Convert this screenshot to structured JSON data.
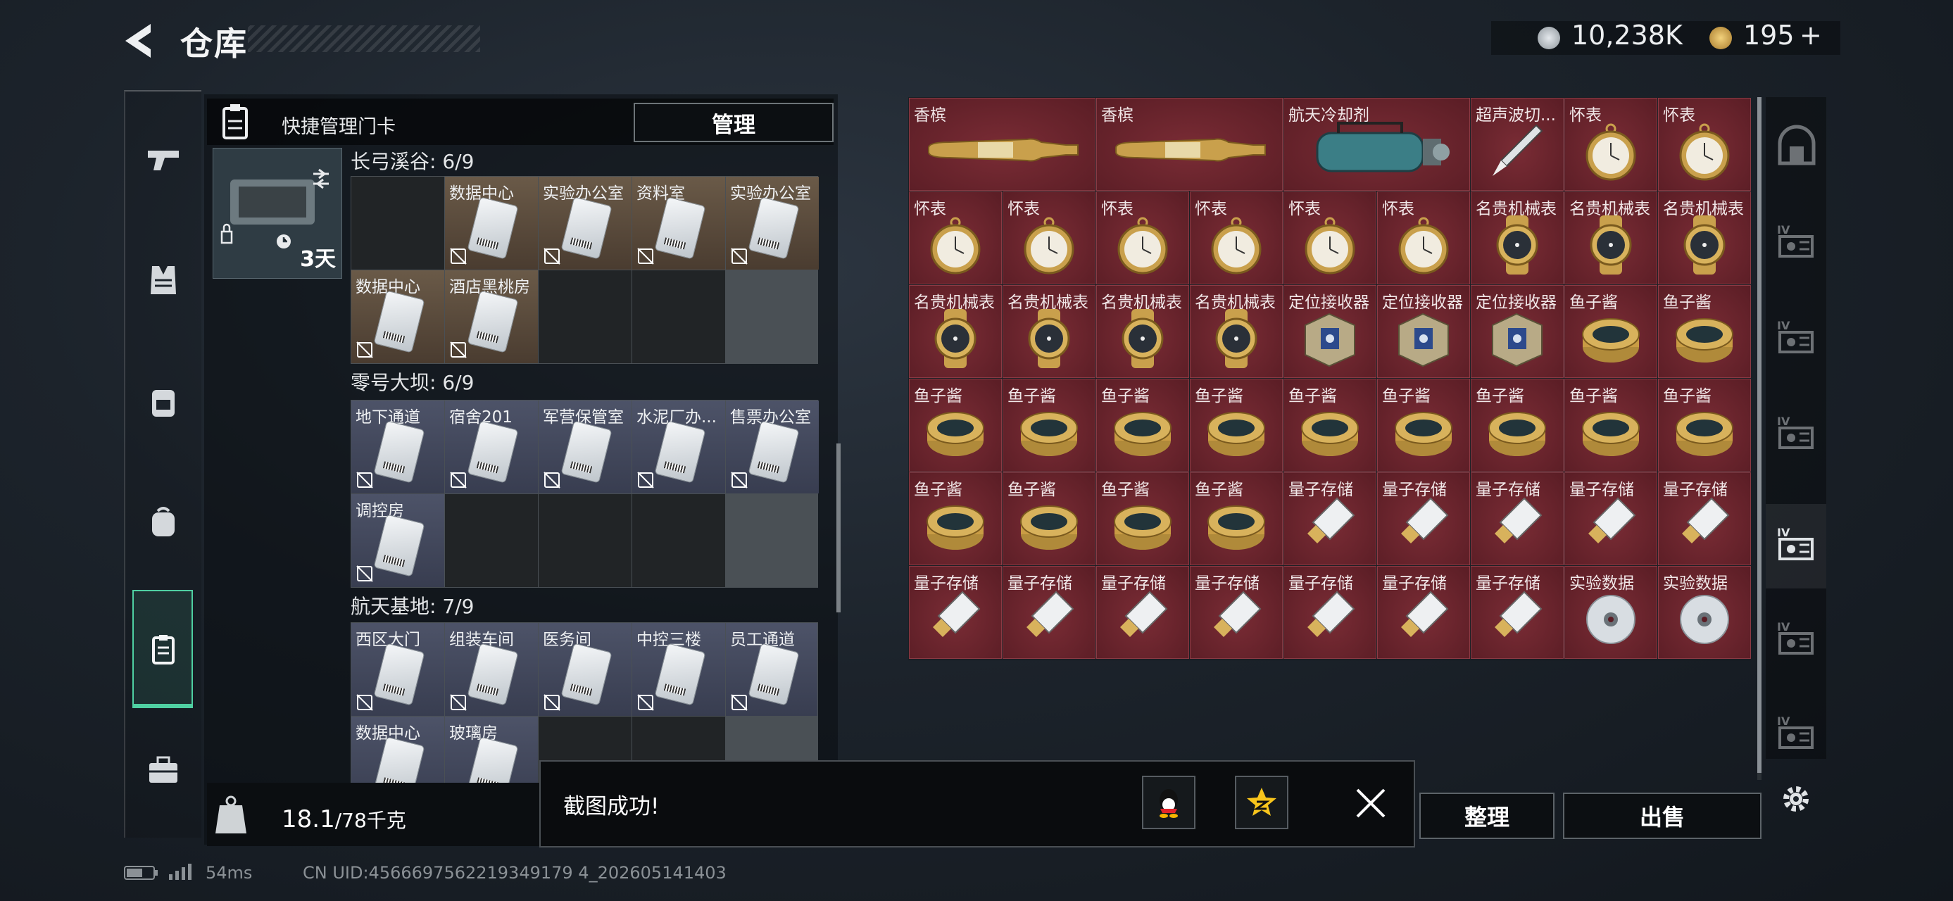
{
  "header": {
    "title": "仓库",
    "currency_silver": "10,238K",
    "currency_gold": "195",
    "gold_plus": "+"
  },
  "colors": {
    "accent": "#4fd0a2",
    "item_red": "#6e2530",
    "card_brown": "#5a4a3a",
    "card_blue": "#454a60"
  },
  "sidebar": {
    "icons": [
      "pistol-icon",
      "armor-vest-icon",
      "backpack-rig-icon",
      "backpack-icon",
      "keycard-holder-icon",
      "toolbox-icon"
    ],
    "active_index": 4
  },
  "key_panel": {
    "header_label": "快捷管理门卡",
    "manage_button": "管理",
    "selected_key_time": "3天",
    "sections": [
      {
        "title": "长弓溪谷: 6/9",
        "tone": "brown",
        "cards": [
          "",
          "数据中心",
          "实验办公室",
          "资料室",
          "实验办公室",
          "数据中心",
          "酒店黑桃房",
          "",
          ""
        ]
      },
      {
        "title": "零号大坝: 6/9",
        "tone": "blue",
        "cards": [
          "地下通道",
          "宿舍201",
          "军营保管室",
          "水泥厂办...",
          "售票办公室",
          "调控房",
          "",
          "",
          ""
        ]
      },
      {
        "title": "航天基地: 7/9",
        "tone": "blue",
        "cards": [
          "西区大门",
          "组装车间",
          "医务间",
          "中控三楼",
          "员工通道",
          "数据中心",
          "玻璃房",
          "",
          ""
        ]
      }
    ],
    "weight_value": "18.1",
    "weight_unit": "/78千克"
  },
  "inventory": {
    "items": [
      {
        "name": "香槟",
        "type": "bottle",
        "span": 2
      },
      {
        "name": "香槟",
        "type": "bottle",
        "span": 2
      },
      {
        "name": "航天冷却剂",
        "type": "coolant",
        "span": 2
      },
      {
        "name": "超声波切...",
        "type": "knife",
        "span": 1
      },
      {
        "name": "怀表",
        "type": "watch",
        "span": 1
      },
      {
        "name": "怀表",
        "type": "watch",
        "span": 1
      },
      {
        "name": "怀表",
        "type": "watch",
        "span": 1
      },
      {
        "name": "怀表",
        "type": "watch",
        "span": 1
      },
      {
        "name": "怀表",
        "type": "watch",
        "span": 1
      },
      {
        "name": "怀表",
        "type": "watch",
        "span": 1
      },
      {
        "name": "怀表",
        "type": "watch",
        "span": 1
      },
      {
        "name": "怀表",
        "type": "watch",
        "span": 1
      },
      {
        "name": "名贵机械表",
        "type": "wristwatch",
        "span": 1
      },
      {
        "name": "名贵机械表",
        "type": "wristwatch",
        "span": 1
      },
      {
        "name": "名贵机械表",
        "type": "wristwatch",
        "span": 1
      },
      {
        "name": "名贵机械表",
        "type": "wristwatch",
        "span": 1
      },
      {
        "name": "名贵机械表",
        "type": "wristwatch",
        "span": 1
      },
      {
        "name": "名贵机械表",
        "type": "wristwatch",
        "span": 1
      },
      {
        "name": "名贵机械表",
        "type": "wristwatch",
        "span": 1
      },
      {
        "name": "定位接收器",
        "type": "receiver",
        "span": 1
      },
      {
        "name": "定位接收器",
        "type": "receiver",
        "span": 1
      },
      {
        "name": "定位接收器",
        "type": "receiver",
        "span": 1
      },
      {
        "name": "鱼子酱",
        "type": "caviar",
        "span": 1
      },
      {
        "name": "鱼子酱",
        "type": "caviar",
        "span": 1
      },
      {
        "name": "鱼子酱",
        "type": "caviar",
        "span": 1
      },
      {
        "name": "鱼子酱",
        "type": "caviar",
        "span": 1
      },
      {
        "name": "鱼子酱",
        "type": "caviar",
        "span": 1
      },
      {
        "name": "鱼子酱",
        "type": "caviar",
        "span": 1
      },
      {
        "name": "鱼子酱",
        "type": "caviar",
        "span": 1
      },
      {
        "name": "鱼子酱",
        "type": "caviar",
        "span": 1
      },
      {
        "name": "鱼子酱",
        "type": "caviar",
        "span": 1
      },
      {
        "name": "鱼子酱",
        "type": "caviar",
        "span": 1
      },
      {
        "name": "鱼子酱",
        "type": "caviar",
        "span": 1
      },
      {
        "name": "鱼子酱",
        "type": "caviar",
        "span": 1
      },
      {
        "name": "鱼子酱",
        "type": "caviar",
        "span": 1
      },
      {
        "name": "鱼子酱",
        "type": "caviar",
        "span": 1
      },
      {
        "name": "鱼子酱",
        "type": "caviar",
        "span": 1
      },
      {
        "name": "量子存储",
        "type": "usb",
        "span": 1
      },
      {
        "name": "量子存储",
        "type": "usb",
        "span": 1
      },
      {
        "name": "量子存储",
        "type": "usb",
        "span": 1
      },
      {
        "name": "量子存储",
        "type": "usb",
        "span": 1
      },
      {
        "name": "量子存储",
        "type": "usb",
        "span": 1
      },
      {
        "name": "量子存储",
        "type": "usb",
        "span": 1
      },
      {
        "name": "量子存储",
        "type": "usb",
        "span": 1
      },
      {
        "name": "量子存储",
        "type": "usb",
        "span": 1
      },
      {
        "name": "量子存储",
        "type": "usb",
        "span": 1
      },
      {
        "name": "量子存储",
        "type": "usb",
        "span": 1
      },
      {
        "name": "量子存储",
        "type": "usb",
        "span": 1
      },
      {
        "name": "量子存储",
        "type": "usb",
        "span": 1
      },
      {
        "name": "实验数据",
        "type": "disc",
        "span": 1
      },
      {
        "name": "实验数据",
        "type": "disc",
        "span": 1
      }
    ]
  },
  "right_nav": {
    "tabs": [
      "vault-icon",
      "storage-case-4-icon",
      "storage-case-4-icon",
      "storage-case-4-icon",
      "storage-case-4-icon",
      "storage-case-4-icon",
      "storage-case-4-icon"
    ],
    "selected_index": 4
  },
  "bottom_actions": {
    "sort_label": "整理",
    "sell_label": "出售"
  },
  "toast": {
    "message": "截图成功!",
    "share_qq": "qq-icon",
    "share_qzone": "qzone-star-icon"
  },
  "status_bar": {
    "ping": "54ms",
    "uid": "CN UID:4566697562219349179 4_202605141403"
  }
}
